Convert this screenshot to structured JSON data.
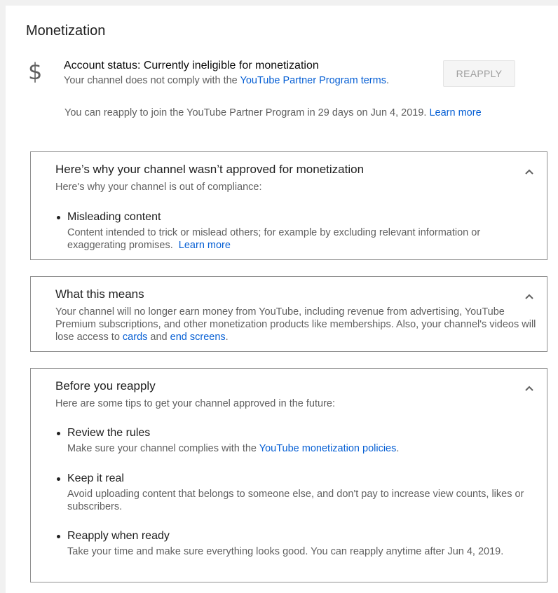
{
  "page": {
    "title": "Monetization"
  },
  "status": {
    "icon": "dollar-icon",
    "icon_glyph": "$",
    "title": "Account status: Currently ineligible for monetization",
    "sub_prefix": "Your channel does not comply with the ",
    "sub_link": "YouTube Partner Program terms",
    "sub_suffix": ".",
    "reapply_button": "REAPPLY",
    "reapply_note": "You can reapply to join the YouTube Partner Program in 29 days on Jun 4, 2019.",
    "reapply_note_link": "Learn more"
  },
  "why_card": {
    "title": "Here’s why your channel wasn’t approved for monetization",
    "subtitle": "Here's why your channel is out of compliance:",
    "item_title": "Misleading content",
    "item_body": "Content intended to trick or mislead others; for example by excluding relevant information or exaggerating promises.",
    "item_link": "Learn more"
  },
  "means_card": {
    "title": "What this means",
    "body_prefix": "Your channel will no longer earn money from YouTube, including revenue from advertising, YouTube Premium subscriptions, and other monetization products like memberships. Also, your channel's videos will lose access to ",
    "link_cards": "cards",
    "and": " and ",
    "link_end_screens": "end screens",
    "period": "."
  },
  "before_card": {
    "title": "Before you reapply",
    "subtitle": "Here are some tips to get your channel approved in the future:",
    "items": [
      {
        "title": "Review the rules",
        "body_prefix": "Make sure your channel complies with the ",
        "body_link": "YouTube monetization policies",
        "body_suffix": "."
      },
      {
        "title": "Keep it real",
        "body": "Avoid uploading content that belongs to someone else, and don't pay to increase view counts, likes or subscribers."
      },
      {
        "title": "Reapply when ready",
        "body": "Take your time and make sure everything looks good. You can reapply anytime after Jun 4, 2019."
      }
    ]
  },
  "colors": {
    "link": "#065fd4",
    "text_primary": "#212121",
    "text_secondary": "#606060",
    "card_border": "#909090"
  }
}
